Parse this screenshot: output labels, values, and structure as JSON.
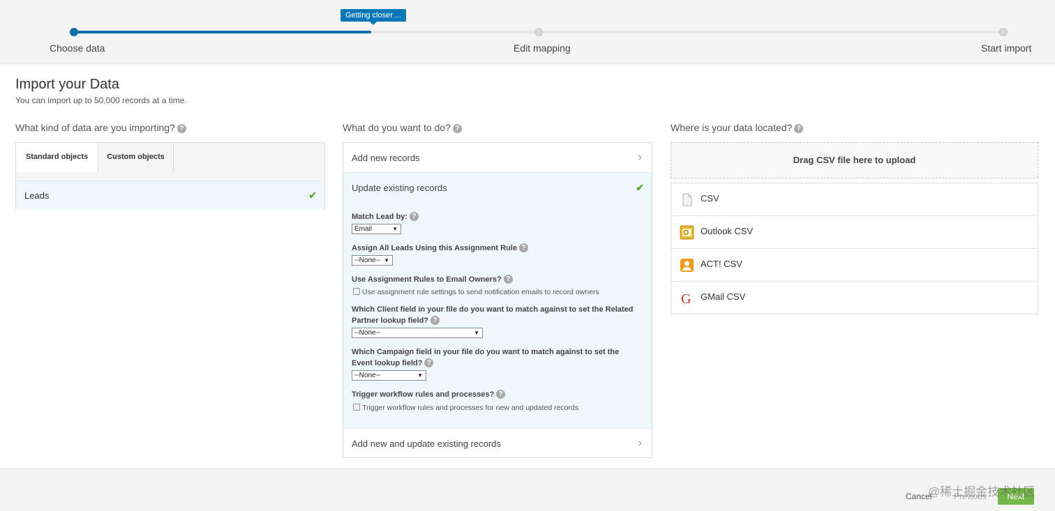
{
  "progress": {
    "tooltip": "Getting closer ...",
    "steps": [
      {
        "label": "Choose data",
        "state": "complete"
      },
      {
        "label": "Edit mapping",
        "state": "pending"
      },
      {
        "label": "Start import",
        "state": "pending"
      }
    ],
    "fill_fraction": 0.32
  },
  "page": {
    "title": "Import your Data",
    "subtitle": "You can import up to 50,000 records at a time."
  },
  "data_kind": {
    "heading": "What kind of data are you importing?",
    "tabs": [
      {
        "label": "Standard objects",
        "active": true
      },
      {
        "label": "Custom objects",
        "active": false
      }
    ],
    "items": [
      {
        "label": "Leads",
        "selected": true
      }
    ]
  },
  "action": {
    "heading": "What do you want to do?",
    "add_new": "Add new records",
    "update_existing": "Update existing records",
    "add_and_update": "Add new and update existing records",
    "match_label": "Match Lead by:",
    "match_value": "Email",
    "assign_label": "Assign All Leads Using this Assignment Rule",
    "assign_value": "--None--",
    "email_owners_label": "Use Assignment Rules to Email Owners?",
    "email_owners_checkbox": "Use assignment rule settings to send notification emails to record owners",
    "client_field_label": "Which Client field in your file do you want to match against to set the Related Partner lookup field?",
    "client_field_value": "--None--",
    "campaign_field_label": "Which Campaign field in your file do you want to match against to set the Event lookup field?",
    "campaign_field_value": "--None--",
    "workflow_label": "Trigger workflow rules and processes?",
    "workflow_checkbox": "Trigger workflow rules and processes for new and updated records"
  },
  "source": {
    "heading": "Where is your data located?",
    "dropzone": "Drag CSV file here to upload",
    "items": [
      {
        "label": "CSV",
        "icon": "csv-file-icon"
      },
      {
        "label": "Outlook CSV",
        "icon": "outlook-icon"
      },
      {
        "label": "ACT! CSV",
        "icon": "act-contact-icon"
      },
      {
        "label": "GMail CSV",
        "icon": "gmail-icon"
      }
    ]
  },
  "footer": {
    "cancel": "Cancel",
    "previous": "Previous",
    "next": "Next",
    "watermark": "@稀土掘金技术社区"
  },
  "colors": {
    "accent": "#0a6fa8",
    "selected_bg": "#eef8fb",
    "check": "#5ea632",
    "next_button": "#74b84a"
  }
}
